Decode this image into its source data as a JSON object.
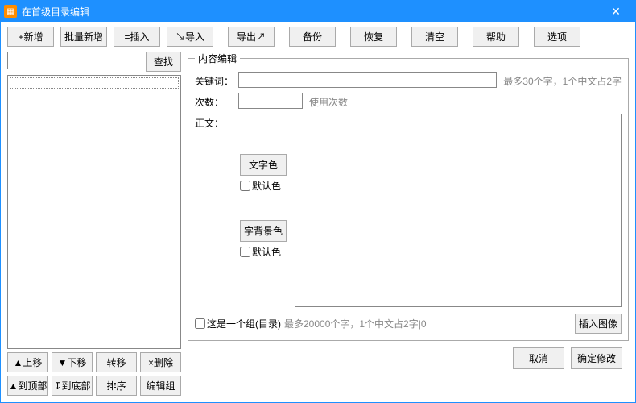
{
  "window": {
    "title": "在首级目录编辑",
    "icon_glyph": "▦"
  },
  "toolbar": {
    "add": "+新增",
    "batch_add": "批量新增",
    "insert": "=插入",
    "import": "↘导入",
    "export": "导出↗",
    "backup": "备份",
    "restore": "恢复",
    "clear": "清空",
    "help": "帮助",
    "options": "选项"
  },
  "left": {
    "search_btn": "查找",
    "move_up": "▲上移",
    "move_down": "▼下移",
    "transfer": "转移",
    "delete": "×删除",
    "to_top": "▲到顶部",
    "to_bottom": "↧到底部",
    "sort": "排序",
    "edit_group": "编辑组"
  },
  "editor": {
    "legend": "内容编辑",
    "keyword_label": "关键词：",
    "keyword_hint": "最多30个字，1个中文占2字",
    "count_label": "次数：",
    "count_hint": "使用次数",
    "body_label": "正文：",
    "text_color": "文字色",
    "default_color1": "默认色",
    "bg_color": "字背景色",
    "default_color2": "默认色",
    "group_checkbox": "这是一个组(目录)",
    "body_hint": "最多20000个字，1个中文占2字|0",
    "insert_image": "插入图像"
  },
  "footer": {
    "cancel": "取消",
    "ok": "确定修改"
  }
}
